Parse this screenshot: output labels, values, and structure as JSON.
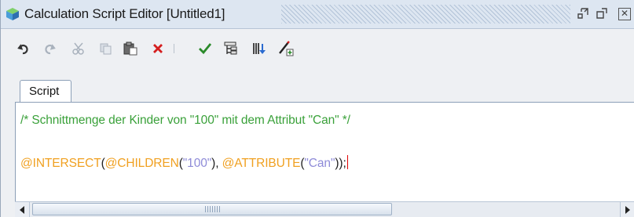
{
  "window": {
    "title": "Calculation Script Editor [Untitled1]",
    "icons": {
      "app": "cube-icon",
      "restore": "restore-icon",
      "maximize": "maximize-icon",
      "close": "close-icon"
    }
  },
  "toolbar": {
    "buttons": [
      {
        "name": "undo",
        "icon": "undo-icon",
        "enabled": true
      },
      {
        "name": "redo",
        "icon": "redo-icon",
        "enabled": false
      },
      {
        "name": "cut",
        "icon": "cut-icon",
        "enabled": false
      },
      {
        "name": "copy",
        "icon": "copy-icon",
        "enabled": false
      },
      {
        "name": "paste",
        "icon": "paste-icon",
        "enabled": true
      },
      {
        "name": "delete",
        "icon": "delete-icon",
        "enabled": true
      },
      {
        "name": "validate",
        "icon": "checkmark-icon",
        "enabled": true
      },
      {
        "name": "member-tree",
        "icon": "tree-icon",
        "enabled": true
      },
      {
        "name": "functions",
        "icon": "functions-icon",
        "enabled": true
      },
      {
        "name": "insert",
        "icon": "pen-insert-icon",
        "enabled": true
      }
    ]
  },
  "tabs": [
    {
      "label": "Script",
      "active": true
    }
  ],
  "editor": {
    "comment": "/* Schnittmenge der Kinder von \"100\" mit dem Attribut \"Can\" */",
    "code_tokens": [
      {
        "text": "@INTERSECT",
        "type": "func"
      },
      {
        "text": "(",
        "type": "plain"
      },
      {
        "text": "@CHILDREN",
        "type": "func"
      },
      {
        "text": "(",
        "type": "plain"
      },
      {
        "text": "\"100\"",
        "type": "str"
      },
      {
        "text": "), ",
        "type": "plain"
      },
      {
        "text": "@ATTRIBUTE",
        "type": "func"
      },
      {
        "text": "(",
        "type": "plain"
      },
      {
        "text": "\"Can\"",
        "type": "str"
      },
      {
        "text": "));",
        "type": "plain"
      }
    ]
  },
  "colors": {
    "comment": "#3aa13a",
    "function": "#f0a020",
    "string": "#8e8bd8",
    "caret": "#e00000"
  }
}
